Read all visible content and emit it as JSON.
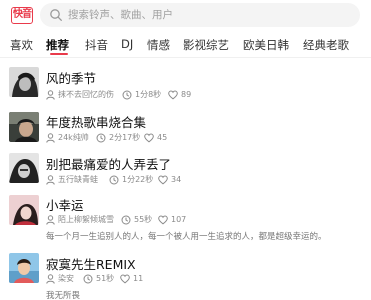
{
  "app": {
    "logo_text": "快音",
    "brand_color": "#e93a4b"
  },
  "search": {
    "placeholder": "搜索铃声、歌曲、用户"
  },
  "tabs": [
    {
      "label": "喜欢"
    },
    {
      "label": "推荐",
      "active": true
    },
    {
      "label": "抖音"
    },
    {
      "label": "DJ"
    },
    {
      "label": "情感"
    },
    {
      "label": "影视综艺"
    },
    {
      "label": "欧美日韩"
    },
    {
      "label": "经典老歌"
    }
  ],
  "songs": [
    {
      "title": "风的季节",
      "user": "抹不去回忆的伤",
      "duration": "1分8秒",
      "likes": "89",
      "description": ""
    },
    {
      "title": "年度热歌串烧合集",
      "user": "24k纯帅",
      "duration": "2分17秒",
      "likes": "45",
      "description": ""
    },
    {
      "title": "别把最痛爱的人弄丢了",
      "user": "五行缺青蛙",
      "duration": "1分22秒",
      "likes": "34",
      "description": ""
    },
    {
      "title": "小幸运",
      "user": "陌上柳絮倾城雪",
      "duration": "55秒",
      "likes": "107",
      "description": "每一个月一生追别人的人，每一个被人用一生追求的人，都是超级幸运的。"
    },
    {
      "title": "寂寞先生REMIX",
      "user": "染安",
      "duration": "51秒",
      "likes": "11",
      "description": "我无所畏"
    }
  ],
  "icons": {
    "search": "search-icon",
    "user": "user-icon",
    "duration": "clock-icon",
    "likes": "heart-icon"
  }
}
